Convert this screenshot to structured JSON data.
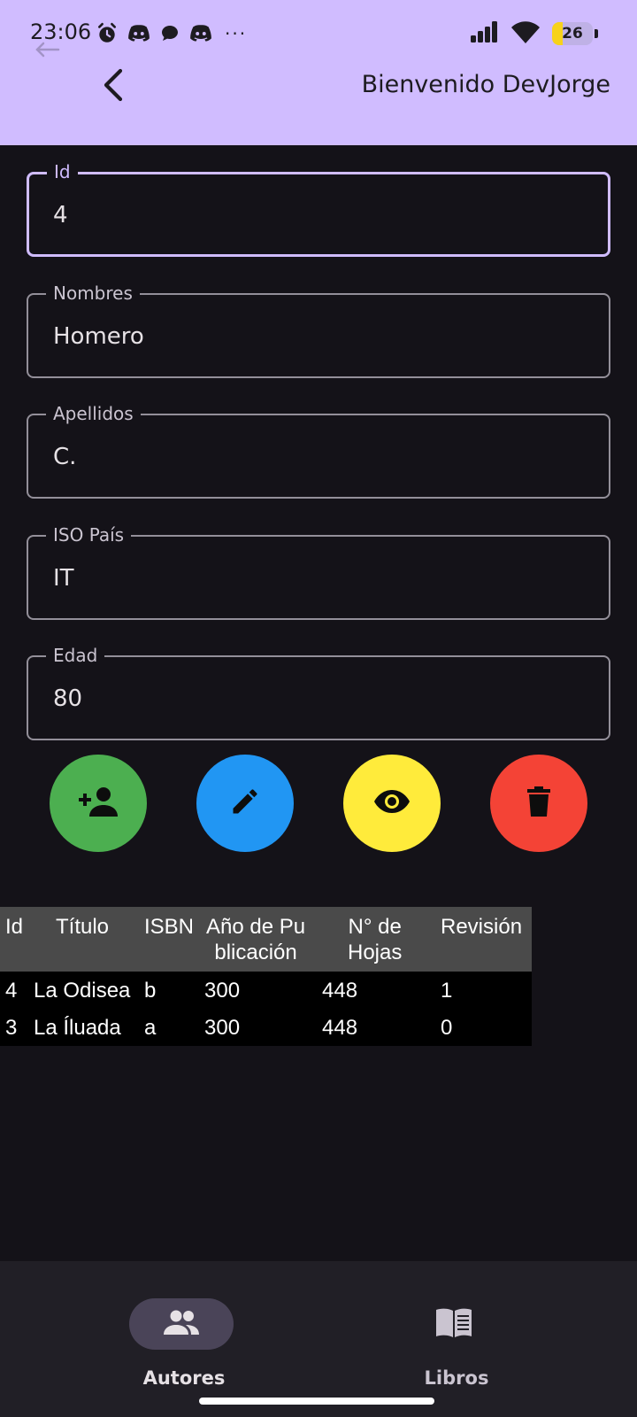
{
  "status_bar": {
    "time": "23:06",
    "battery_level": "26",
    "battery_fraction": 0.26,
    "more_indicator": "···",
    "left_icons": [
      "alarm-icon",
      "discord-icon",
      "chat-bubble-icon",
      "discord-icon"
    ],
    "right_icons": [
      "signal-icon",
      "wifi-icon",
      "battery-icon"
    ]
  },
  "app_bar": {
    "title": "Bienvenido DevJorge",
    "back_icon": "chevron-left-icon",
    "background": "#d0bcff"
  },
  "form": {
    "fields": [
      {
        "label": "Id",
        "value": "4",
        "focused": true
      },
      {
        "label": "Nombres",
        "value": "Homero",
        "focused": false
      },
      {
        "label": "Apellidos",
        "value": "C.",
        "focused": false
      },
      {
        "label": "ISO País",
        "value": "IT",
        "focused": false
      },
      {
        "label": "Edad",
        "value": "80",
        "focused": false
      }
    ]
  },
  "actions": [
    {
      "name": "add-person",
      "icon": "person-add-icon",
      "color": "#4caf50"
    },
    {
      "name": "edit",
      "icon": "pencil-icon",
      "color": "#2196f3"
    },
    {
      "name": "view",
      "icon": "eye-icon",
      "color": "#ffeb3b"
    },
    {
      "name": "delete",
      "icon": "trash-icon",
      "color": "#f44336"
    }
  ],
  "books_table": {
    "headers": [
      "Id",
      "Título",
      "ISBN",
      "Año de Pu blicación",
      "N° de Hojas",
      "Revisión"
    ],
    "header_lines": [
      [
        "Id"
      ],
      [
        "Título"
      ],
      [
        "ISBN"
      ],
      [
        "Año de Pu",
        "blicación"
      ],
      [
        "N° de",
        "Hojas"
      ],
      [
        "Revisión"
      ]
    ],
    "rows": [
      [
        "4",
        "La Odisea",
        "b",
        "300",
        "448",
        "1"
      ],
      [
        "3",
        "La Íluada",
        "a",
        "300",
        "448",
        "0"
      ]
    ]
  },
  "bottom_nav": {
    "items": [
      {
        "label": "Autores",
        "icon": "people-icon",
        "active": true
      },
      {
        "label": "Libros",
        "icon": "book-icon",
        "active": false
      }
    ]
  }
}
